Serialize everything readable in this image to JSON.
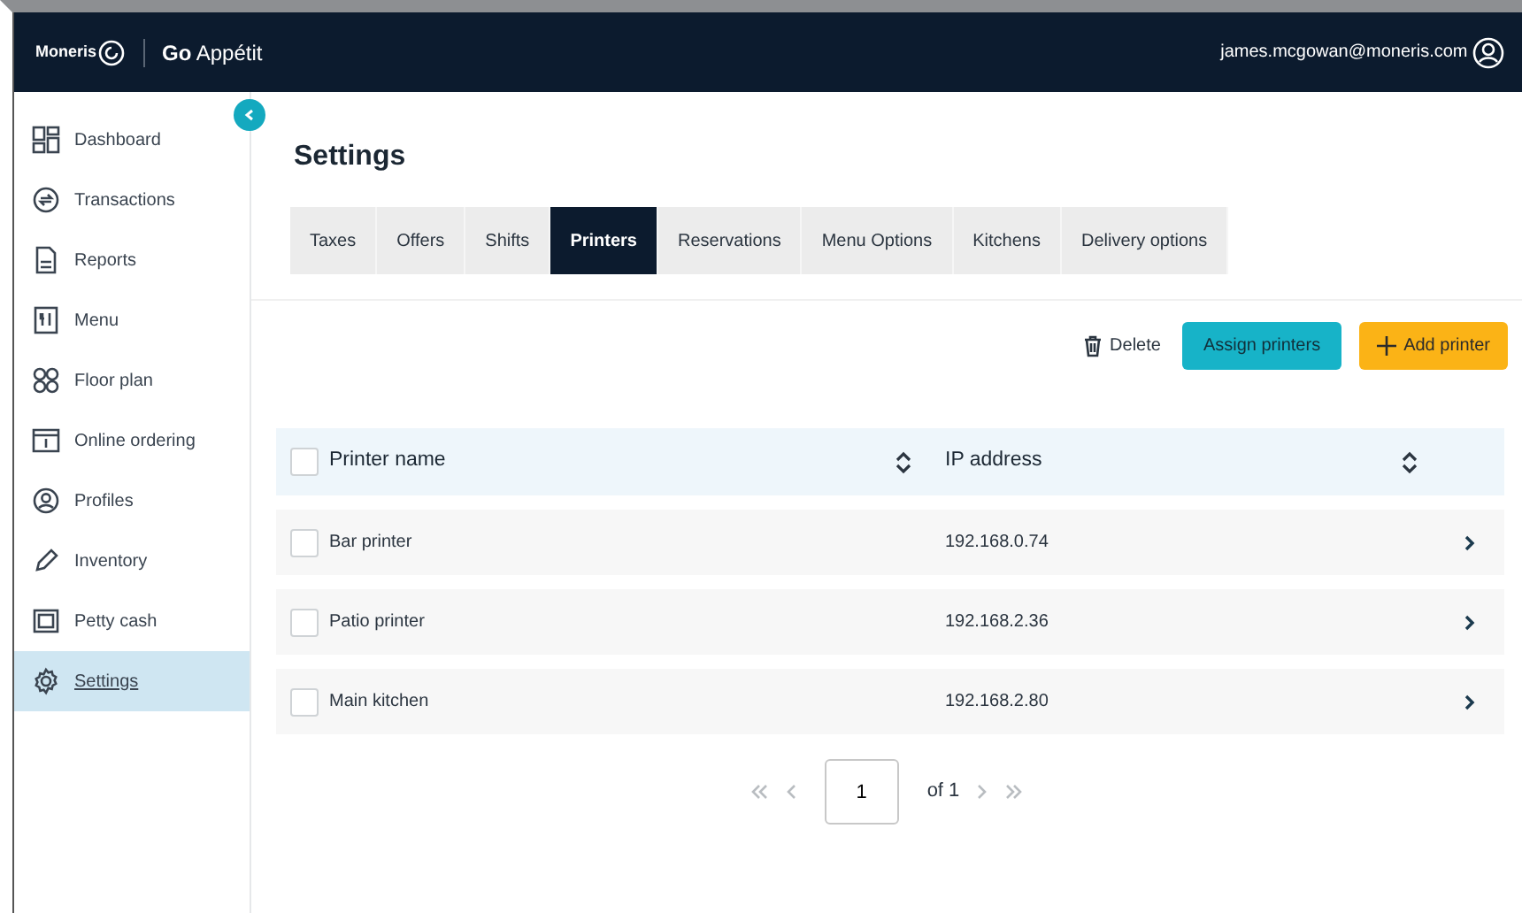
{
  "header": {
    "brand": "Moneris",
    "product_bold": "Go",
    "product": "Appétit",
    "user_email": "james.mcgowan@moneris.com"
  },
  "sidebar": {
    "items": [
      {
        "label": "Dashboard",
        "selected": false
      },
      {
        "label": "Transactions",
        "selected": false
      },
      {
        "label": "Reports",
        "selected": false
      },
      {
        "label": "Menu",
        "selected": false
      },
      {
        "label": "Floor plan",
        "selected": false
      },
      {
        "label": "Online ordering",
        "selected": false
      },
      {
        "label": "Profiles",
        "selected": false
      },
      {
        "label": "Inventory",
        "selected": false
      },
      {
        "label": "Petty cash",
        "selected": false
      },
      {
        "label": "Settings",
        "selected": true
      }
    ]
  },
  "page_title": "Settings",
  "tabs": [
    {
      "label": "Taxes",
      "selected": false
    },
    {
      "label": "Offers",
      "selected": false
    },
    {
      "label": "Shifts",
      "selected": false
    },
    {
      "label": "Printers",
      "selected": true
    },
    {
      "label": "Reservations",
      "selected": false
    },
    {
      "label": "Menu Options",
      "selected": false
    },
    {
      "label": "Kitchens",
      "selected": false
    },
    {
      "label": "Delivery options",
      "selected": false
    }
  ],
  "actions": {
    "delete": "Delete",
    "assign": "Assign printers",
    "add": "Add printer"
  },
  "table": {
    "columns": [
      "Printer name",
      "IP address"
    ],
    "header_checked": false,
    "rows": [
      {
        "name": "Bar printer",
        "ip": "192.168.0.74",
        "checked": false
      },
      {
        "name": "Patio printer",
        "ip": "192.168.2.36",
        "checked": false
      },
      {
        "name": "Main kitchen",
        "ip": "192.168.2.80",
        "checked": false
      }
    ]
  },
  "pagination": {
    "page": "1",
    "of": "of 1"
  }
}
